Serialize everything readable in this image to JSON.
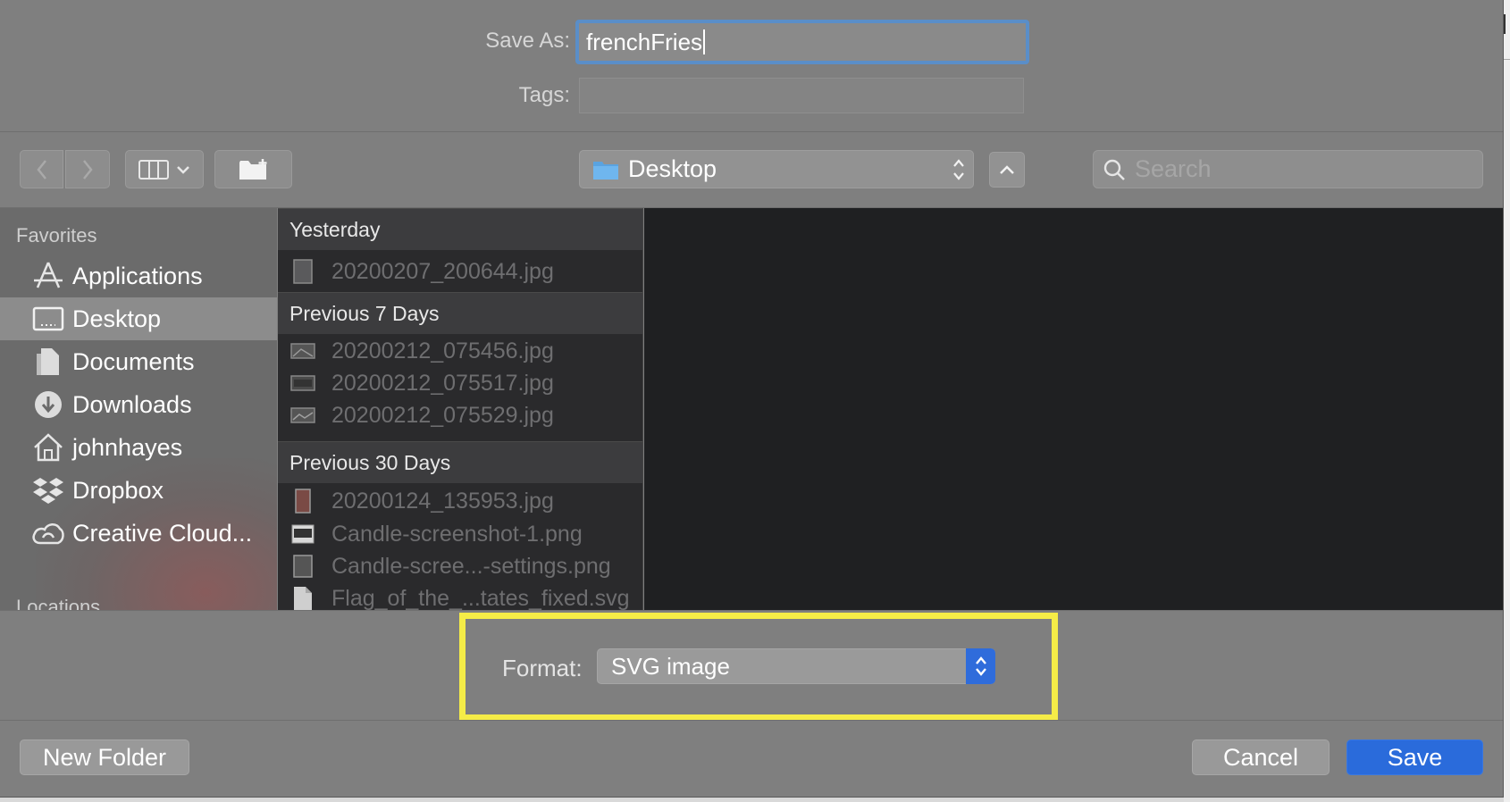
{
  "form": {
    "save_as_label": "Save As:",
    "save_as_value": "frenchFries",
    "tags_label": "Tags:"
  },
  "toolbar": {
    "location": "Desktop",
    "search_placeholder": "Search"
  },
  "sidebar": {
    "favorites_title": "Favorites",
    "locations_title": "Locations",
    "items": [
      {
        "label": "Applications",
        "icon": "applications-icon"
      },
      {
        "label": "Desktop",
        "icon": "desktop-icon",
        "selected": true
      },
      {
        "label": "Documents",
        "icon": "documents-icon"
      },
      {
        "label": "Downloads",
        "icon": "downloads-icon"
      },
      {
        "label": "johnhayes",
        "icon": "home-icon"
      },
      {
        "label": "Dropbox",
        "icon": "dropbox-icon"
      },
      {
        "label": "Creative Cloud...",
        "icon": "creative-cloud-icon"
      }
    ]
  },
  "files": {
    "groups": [
      {
        "title": "Yesterday",
        "items": [
          "20200207_200644.jpg"
        ]
      },
      {
        "title": "Previous 7 Days",
        "items": [
          "20200212_075456.jpg",
          "20200212_075517.jpg",
          "20200212_075529.jpg"
        ]
      },
      {
        "title": "Previous 30 Days",
        "items": [
          "20200124_135953.jpg",
          "Candle-screenshot-1.png",
          "Candle-scree...-settings.png",
          "Flag_of_the_...tates_fixed.svg"
        ]
      }
    ]
  },
  "format": {
    "label": "Format:",
    "value": "SVG image"
  },
  "buttons": {
    "new_folder": "New Folder",
    "cancel": "Cancel",
    "save": "Save"
  },
  "colors": {
    "accent": "#2a6bdb",
    "highlight": "#f5ec47",
    "focus_ring": "#5a8ec8"
  }
}
